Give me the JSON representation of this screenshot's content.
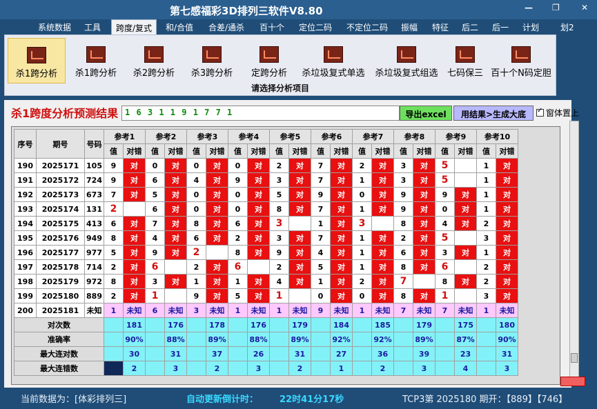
{
  "app": {
    "title": "第七感福彩3D排列三软件V8.80",
    "min": "—",
    "max": "❐",
    "close": "✕"
  },
  "menu": [
    "系统数据",
    "工具",
    "跨度/复式",
    "和/合值",
    "合差/通杀",
    "百十个",
    "定位二码",
    "不定位二码",
    "振幅",
    "特征",
    "后二",
    "后一",
    "计划",
    "划2"
  ],
  "ribbon": {
    "buttons": [
      "杀1跨分析",
      "杀1跨分析",
      "杀2跨分析",
      "杀3跨分析",
      "定跨分析",
      "杀垃圾复式单选",
      "杀垃圾复式组选",
      "七码保三",
      "百十个N码定胆"
    ],
    "caption": "请选择分析项目"
  },
  "result": {
    "heading": "杀1跨度分析预测结果",
    "value": "1 6 3 1 1 9 1 7 7 1",
    "export_label": "导出excel",
    "generate_label": "用结果>生成大底",
    "ontop_label": "窗体置上"
  },
  "table": {
    "head_seq": "序号",
    "head_issue": "期号",
    "head_num": "号码",
    "refs": [
      "参考1",
      "参考2",
      "参考3",
      "参考4",
      "参考5",
      "参考6",
      "参考7",
      "参考8",
      "参考9",
      "参考10"
    ],
    "sub_val": "值",
    "sub_mark": "对错",
    "rows": [
      {
        "seq": "190",
        "issue": "2025171",
        "num": "105",
        "cells": [
          [
            "9",
            "对"
          ],
          [
            "0",
            "对"
          ],
          [
            "0",
            "对"
          ],
          [
            "0",
            "对"
          ],
          [
            "2",
            "对"
          ],
          [
            "7",
            "对"
          ],
          [
            "2",
            "对"
          ],
          [
            "3",
            "对"
          ],
          [
            "5",
            ""
          ],
          [
            "1",
            "对"
          ]
        ]
      },
      {
        "seq": "191",
        "issue": "2025172",
        "num": "724",
        "cells": [
          [
            "9",
            "对"
          ],
          [
            "6",
            "对"
          ],
          [
            "4",
            "对"
          ],
          [
            "9",
            "对"
          ],
          [
            "3",
            "对"
          ],
          [
            "7",
            "对"
          ],
          [
            "1",
            "对"
          ],
          [
            "3",
            "对"
          ],
          [
            "5",
            ""
          ],
          [
            "1",
            "对"
          ]
        ]
      },
      {
        "seq": "192",
        "issue": "2025173",
        "num": "673",
        "cells": [
          [
            "7",
            "对"
          ],
          [
            "5",
            "对"
          ],
          [
            "0",
            "对"
          ],
          [
            "0",
            "对"
          ],
          [
            "5",
            "对"
          ],
          [
            "9",
            "对"
          ],
          [
            "0",
            "对"
          ],
          [
            "9",
            "对"
          ],
          [
            "9",
            "对"
          ],
          [
            "1",
            "对"
          ]
        ]
      },
      {
        "seq": "193",
        "issue": "2025174",
        "num": "131",
        "cells": [
          [
            "2",
            ""
          ],
          [
            "6",
            "对"
          ],
          [
            "0",
            "对"
          ],
          [
            "0",
            "对"
          ],
          [
            "8",
            "对"
          ],
          [
            "7",
            "对"
          ],
          [
            "1",
            "对"
          ],
          [
            "9",
            "对"
          ],
          [
            "0",
            "对"
          ],
          [
            "1",
            "对"
          ]
        ]
      },
      {
        "seq": "194",
        "issue": "2025175",
        "num": "413",
        "cells": [
          [
            "6",
            "对"
          ],
          [
            "7",
            "对"
          ],
          [
            "8",
            "对"
          ],
          [
            "6",
            "对"
          ],
          [
            "3",
            ""
          ],
          [
            "1",
            "对"
          ],
          [
            "3",
            ""
          ],
          [
            "8",
            "对"
          ],
          [
            "4",
            "对"
          ],
          [
            "2",
            "对"
          ]
        ]
      },
      {
        "seq": "195",
        "issue": "2025176",
        "num": "949",
        "cells": [
          [
            "8",
            "对"
          ],
          [
            "4",
            "对"
          ],
          [
            "6",
            "对"
          ],
          [
            "2",
            "对"
          ],
          [
            "3",
            "对"
          ],
          [
            "7",
            "对"
          ],
          [
            "1",
            "对"
          ],
          [
            "2",
            "对"
          ],
          [
            "5",
            ""
          ],
          [
            "3",
            "对"
          ]
        ]
      },
      {
        "seq": "196",
        "issue": "2025177",
        "num": "977",
        "cells": [
          [
            "5",
            "对"
          ],
          [
            "9",
            "对"
          ],
          [
            "2",
            ""
          ],
          [
            "8",
            "对"
          ],
          [
            "9",
            "对"
          ],
          [
            "4",
            "对"
          ],
          [
            "1",
            "对"
          ],
          [
            "6",
            "对"
          ],
          [
            "3",
            "对"
          ],
          [
            "1",
            "对"
          ]
        ]
      },
      {
        "seq": "197",
        "issue": "2025178",
        "num": "714",
        "cells": [
          [
            "2",
            "对"
          ],
          [
            "6",
            ""
          ],
          [
            "2",
            "对"
          ],
          [
            "6",
            ""
          ],
          [
            "2",
            "对"
          ],
          [
            "5",
            "对"
          ],
          [
            "1",
            "对"
          ],
          [
            "8",
            "对"
          ],
          [
            "6",
            ""
          ],
          [
            "2",
            "对"
          ]
        ]
      },
      {
        "seq": "198",
        "issue": "2025179",
        "num": "972",
        "cells": [
          [
            "8",
            "对"
          ],
          [
            "3",
            "对"
          ],
          [
            "1",
            "对"
          ],
          [
            "1",
            "对"
          ],
          [
            "4",
            "对"
          ],
          [
            "1",
            "对"
          ],
          [
            "2",
            "对"
          ],
          [
            "7",
            ""
          ],
          [
            "8",
            "对"
          ],
          [
            "2",
            "对"
          ]
        ]
      },
      {
        "seq": "199",
        "issue": "2025180",
        "num": "889",
        "cells": [
          [
            "2",
            "对"
          ],
          [
            "1",
            ""
          ],
          [
            "9",
            "对"
          ],
          [
            "5",
            "对"
          ],
          [
            "1",
            ""
          ],
          [
            "0",
            "对"
          ],
          [
            "0",
            "对"
          ],
          [
            "8",
            "对"
          ],
          [
            "1",
            ""
          ],
          [
            "3",
            "对"
          ]
        ]
      }
    ],
    "pending": {
      "seq": "200",
      "issue": "2025181",
      "num": "未知",
      "cells": [
        [
          "1",
          "未知"
        ],
        [
          "6",
          "未知"
        ],
        [
          "3",
          "未知"
        ],
        [
          "1",
          "未知"
        ],
        [
          "1",
          "未知"
        ],
        [
          "9",
          "未知"
        ],
        [
          "1",
          "未知"
        ],
        [
          "7",
          "未知"
        ],
        [
          "7",
          "未知"
        ],
        [
          "1",
          "未知"
        ]
      ]
    },
    "stats": [
      {
        "label": "对次数",
        "values": [
          "181",
          "176",
          "178",
          "176",
          "179",
          "184",
          "185",
          "179",
          "175",
          "180"
        ]
      },
      {
        "label": "准确率",
        "values": [
          "90%",
          "88%",
          "89%",
          "88%",
          "89%",
          "92%",
          "92%",
          "89%",
          "87%",
          "90%"
        ]
      },
      {
        "label": "最大连对数",
        "values": [
          "30",
          "31",
          "37",
          "26",
          "31",
          "27",
          "36",
          "39",
          "23",
          "31"
        ]
      },
      {
        "label": "最大连错数",
        "values": [
          "2",
          "3",
          "2",
          "3",
          "2",
          "1",
          "2",
          "3",
          "4",
          "3"
        ]
      }
    ]
  },
  "status": {
    "data_label": "当前数据为：[体彩排列三]",
    "countdown_label": "自动更新倒计时：",
    "countdown_value": "22时41分17秒",
    "draw": "TCP3第 2025180 期开：【889】【746】"
  }
}
